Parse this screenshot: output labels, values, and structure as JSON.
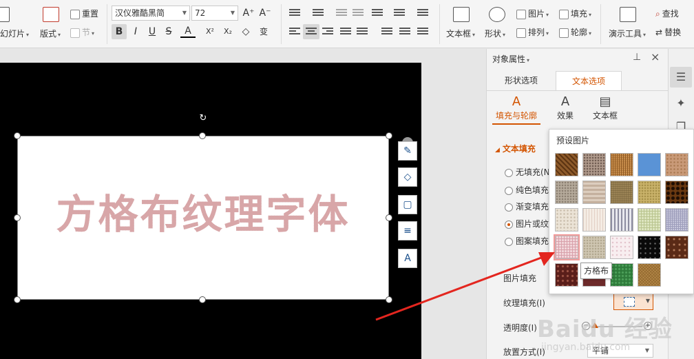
{
  "ribbon": {
    "slides_label": "幻灯片",
    "layout_label": "版式",
    "reset_label": "重置",
    "section_label": "节",
    "font_name": "汉仪雅酷黑简",
    "font_size": "72",
    "grow_font": "A⁺",
    "shrink_font": "A⁻",
    "bold": "B",
    "italic": "I",
    "underline": "U",
    "strike": "S",
    "font_color": "A",
    "superscript": "X²",
    "subscript": "X₂",
    "clear": "◇",
    "pinyin": "变",
    "textbox_label": "文本框",
    "shape_label": "形状",
    "picture_label": "图片",
    "arrange_label": "排列",
    "fill_label": "填充",
    "outline_label": "轮廓",
    "presentation_tools_label": "演示工具",
    "find_label": "查找",
    "replace_label": "替换"
  },
  "slide": {
    "text": "方格布纹理字体"
  },
  "panel": {
    "title": "对象属性",
    "tab_shape": "形状选项",
    "tab_text": "文本选项",
    "subtab_fill": "填充与轮廓",
    "subtab_effect": "效果",
    "subtab_textbox": "文本框",
    "section_text_fill": "文本填充",
    "radio_none": "无填充(N",
    "radio_solid": "纯色填充",
    "radio_gradient": "渐变填充",
    "radio_picture": "图片或纹",
    "radio_pattern": "图案填充",
    "picture_fill_label": "图片填充",
    "texture_fill_label": "纹理填充(I)",
    "transparency_label": "透明度(I)",
    "placement_label": "放置方式(I)",
    "placement_value": "平铺"
  },
  "popup": {
    "title": "预设图片",
    "tooltip": "方格布",
    "selected_texture": "方格布"
  },
  "watermark": {
    "text": "Baidu 经验",
    "url": "jingyan.baidu.com"
  },
  "colors": {
    "accent": "#d35400",
    "arrow": "#e3261f"
  }
}
